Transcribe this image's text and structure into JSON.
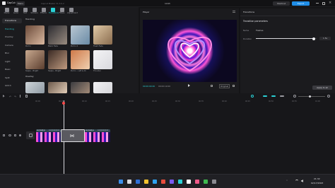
{
  "app": {
    "name": "CapCut",
    "menu": "Menu",
    "project": "Capcut Master 31.3.0.2",
    "doc_title": "1163",
    "shortcut": "Shortcut",
    "export": "Export"
  },
  "toolbar": {
    "items": [
      {
        "label": "Media",
        "icon": "media-icon"
      },
      {
        "label": "Audio",
        "icon": "audio-icon"
      },
      {
        "label": "Text",
        "icon": "text-icon"
      },
      {
        "label": "Stickers",
        "icon": "stickers-icon"
      },
      {
        "label": "Effects",
        "icon": "effects-icon"
      },
      {
        "label": "Transitions",
        "icon": "transitions-icon",
        "active": true
      },
      {
        "label": "Filters",
        "icon": "filters-icon"
      },
      {
        "label": "Adjustment",
        "icon": "adjustment-icon"
      }
    ]
  },
  "left_nav": {
    "items": [
      "Transitions",
      "Trending",
      "Overlay",
      "Camera",
      "Blur",
      "Light",
      "Basic",
      "Split",
      "Glitch"
    ]
  },
  "library": {
    "section1": "Trending",
    "section2": "Overlay",
    "row1": [
      "Pull In",
      "Black Fade",
      "Pull In II",
      "Flash Fade"
    ],
    "row2": [
      "Swipe - Bright",
      "Swipe - Bright",
      "Pull In - Left & Ri",
      "Thunder"
    ]
  },
  "player": {
    "title": "Player",
    "timecode": "00:00:00:26",
    "duration": "00:00:19:00",
    "ratio": "Original",
    "ratio_btn": "Ratio"
  },
  "properties": {
    "title": "Transitions",
    "subtitle": "Transition parameters",
    "name_label": "Name",
    "name_value": "Flashes",
    "duration_label": "Duration",
    "duration_value": "1.5s",
    "duration_fraction": 0.95,
    "apply_all": "Apply to all"
  },
  "timeline": {
    "ruler": [
      "00:00",
      "00:05",
      "00:10",
      "00:15",
      "00:20",
      "00:25",
      "00:30",
      "00:35",
      "00:40",
      "00:45",
      "00:50",
      "00:55",
      "01:00"
    ],
    "clip_labels": [
      "Animation",
      "1000000000",
      "Animation",
      "1000000000"
    ],
    "cover": "Cover"
  },
  "taskbar": {
    "time": "21:32",
    "date": "02/17/2023"
  },
  "colors": {
    "accent": "#2ad1d6",
    "export": "#1f8ee8",
    "timeline_clip": "#2f4450",
    "bg": "#141416"
  }
}
